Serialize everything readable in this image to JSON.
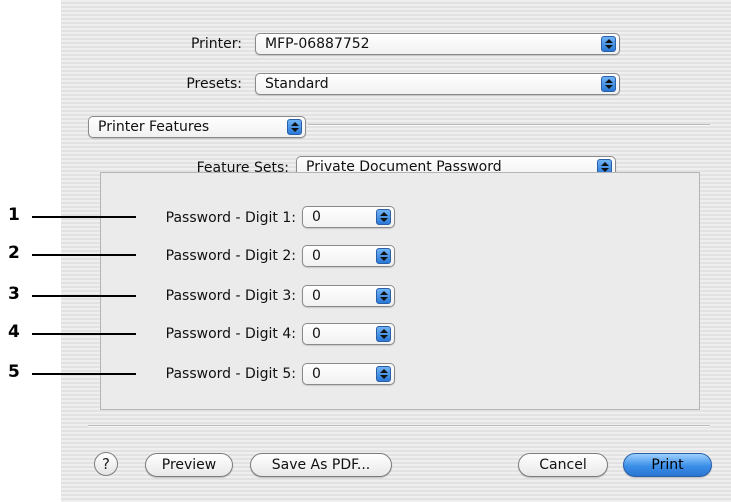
{
  "printer": {
    "label": "Printer:",
    "value": "MFP-06887752"
  },
  "presets": {
    "label": "Presets:",
    "value": "Standard"
  },
  "pane_menu": {
    "value": "Printer Features"
  },
  "feature_sets": {
    "label": "Feature Sets:",
    "value": "Private Document Password"
  },
  "password_digits": [
    {
      "callout": "1",
      "label": "Password - Digit 1:",
      "value": "0"
    },
    {
      "callout": "2",
      "label": "Password - Digit 2:",
      "value": "0"
    },
    {
      "callout": "3",
      "label": "Password - Digit 3:",
      "value": "0"
    },
    {
      "callout": "4",
      "label": "Password - Digit 4:",
      "value": "0"
    },
    {
      "callout": "5",
      "label": "Password - Digit 5:",
      "value": "0"
    }
  ],
  "buttons": {
    "help": "?",
    "preview": "Preview",
    "save_as_pdf": "Save As PDF...",
    "cancel": "Cancel",
    "print": "Print"
  }
}
